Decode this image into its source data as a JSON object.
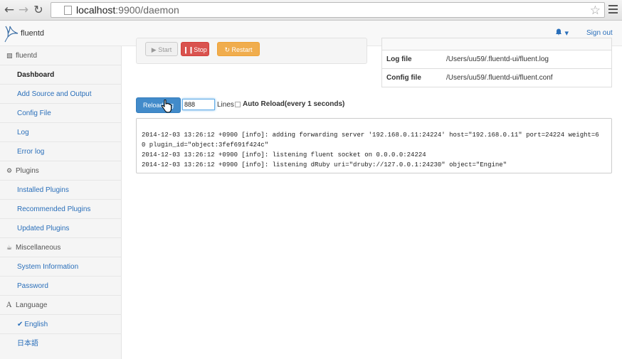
{
  "browser": {
    "url_host": "localhost",
    "url_rest": ":9900/daemon"
  },
  "navbar": {
    "brand": "fluentd",
    "bell_caret": "▾",
    "signout": "Sign out"
  },
  "sidebar": {
    "items": [
      {
        "label": "fluentd",
        "type": "head",
        "icon": "sitemap-icon"
      },
      {
        "label": "Dashboard",
        "type": "link",
        "active": true
      },
      {
        "label": "Add Source and Output",
        "type": "link"
      },
      {
        "label": "Config File",
        "type": "link"
      },
      {
        "label": "Log",
        "type": "link"
      },
      {
        "label": "Error log",
        "type": "link"
      },
      {
        "label": "Plugins",
        "type": "head",
        "icon": "gears-icon"
      },
      {
        "label": "Installed Plugins",
        "type": "link"
      },
      {
        "label": "Recommended Plugins",
        "type": "link"
      },
      {
        "label": "Updated Plugins",
        "type": "link"
      },
      {
        "label": "Miscellaneous",
        "type": "head",
        "icon": "coffee-icon"
      },
      {
        "label": "System Information",
        "type": "link"
      },
      {
        "label": "Password",
        "type": "link"
      },
      {
        "label": "Language",
        "type": "head",
        "icon": "font-icon"
      },
      {
        "label": "English",
        "type": "link",
        "checked": true
      },
      {
        "label": "日本語",
        "type": "link"
      }
    ]
  },
  "controls": {
    "start": "Start",
    "stop": "Stop",
    "restart": "Restart"
  },
  "info": {
    "log_file_label": "Log file",
    "log_file_value": "/Users/uu59/.fluentd-ui/fluent.log",
    "config_file_label": "Config file",
    "config_file_value": "/Users/uu59/.fluentd-ui/fluent.conf"
  },
  "log_toolbar": {
    "reload_label": "Reload log",
    "lines_value": "888",
    "lines_label": "Lines",
    "auto_reload_label": "Auto Reload(every 1 seconds)"
  },
  "log_lines": [
    "2014-12-03 13:26:12 +0900 [info]: adding forwarding server '192.168.0.11:24224' host=\"192.168.0.11\" port=24224 weight=6",
    "0 plugin_id=\"object:3fef691f424c\"",
    "2014-12-03 13:26:12 +0900 [info]: listening fluent socket on 0.0.0.0:24224",
    "2014-12-03 13:26:12 +0900 [info]: listening dRuby uri=\"druby://127.0.0.1:24230\" object=\"Engine\""
  ],
  "colors": {
    "link": "#2a6fba",
    "stop": "#d9534f",
    "restart": "#f0ad4e",
    "primary": "#428bca"
  }
}
